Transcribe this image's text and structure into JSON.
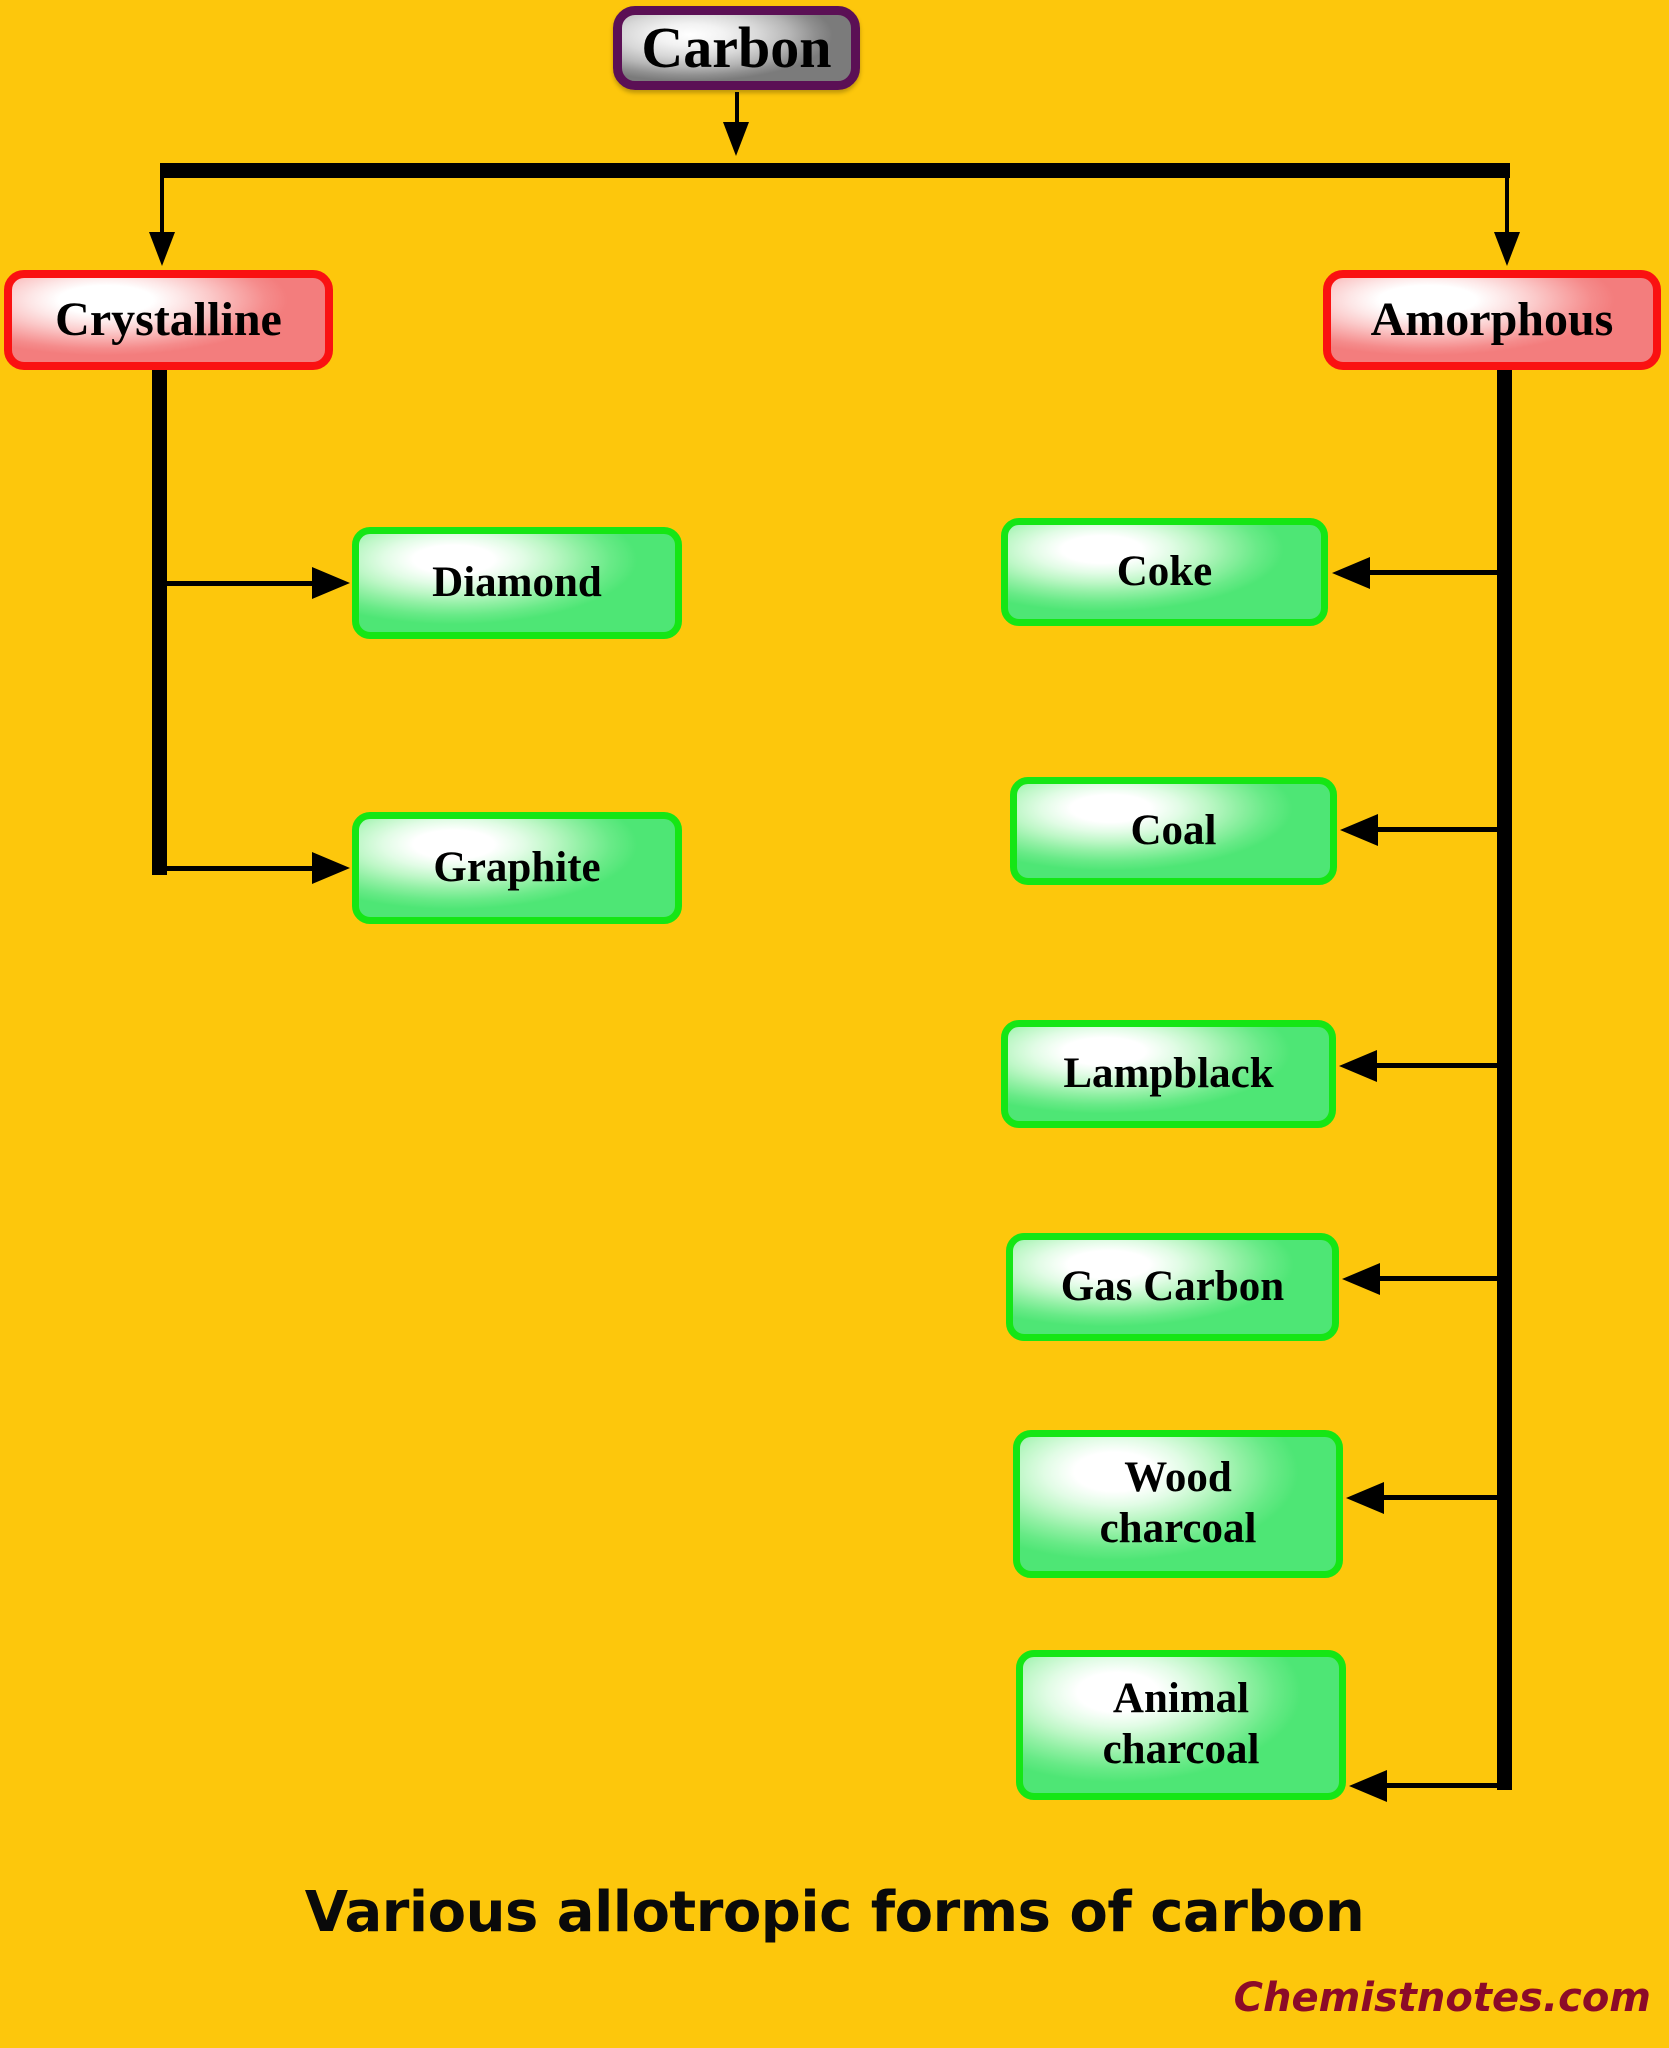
{
  "diagram": {
    "title": "Various allotropic forms of carbon",
    "background_color": "#FDC70C",
    "root": {
      "label": "Carbon",
      "border_color": "#5B1055",
      "fill": "silver-gradient"
    },
    "categories": [
      {
        "label": "Crystalline",
        "border_color": "#FA1111",
        "fill": "white-to-pink-gradient",
        "children": [
          "Diamond",
          "Graphite"
        ]
      },
      {
        "label": "Amorphous",
        "border_color": "#FA1111",
        "fill": "white-to-pink-gradient",
        "children": [
          "Coke",
          "Coal",
          "Lampblack",
          "Gas Carbon",
          "Wood charcoal",
          "Animal charcoal"
        ]
      }
    ],
    "crystalline_forms": [
      {
        "label": "Diamond"
      },
      {
        "label": "Graphite"
      }
    ],
    "amorphous_forms": [
      {
        "label": "Coke"
      },
      {
        "label": "Coal"
      },
      {
        "label": "Lampblack"
      },
      {
        "label": "Gas Carbon"
      },
      {
        "label_line1": "Wood",
        "label_line2": "charcoal"
      },
      {
        "label_line1": "Animal",
        "label_line2": "charcoal"
      }
    ],
    "leaf_border_color": "#15E615",
    "connector_color": "#000000"
  },
  "caption": "Various allotropic forms of carbon",
  "watermark": "Chemistnotes.com"
}
